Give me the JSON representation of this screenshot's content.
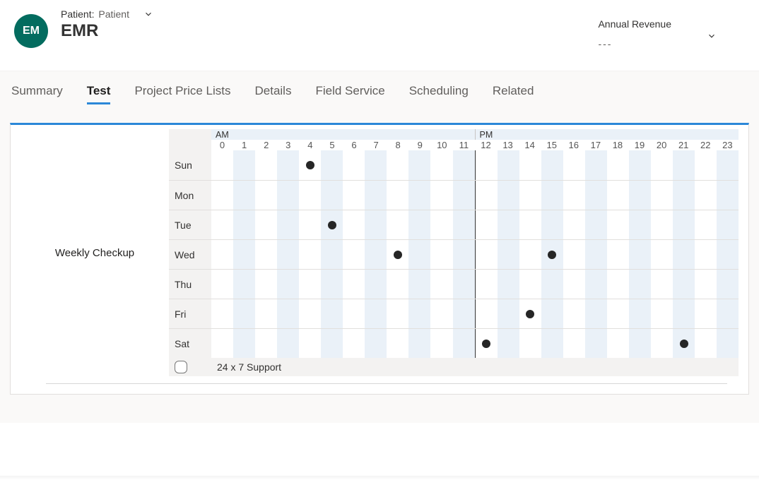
{
  "header": {
    "avatar_initials": "EM",
    "patient_label_prefix": "Patient:",
    "patient_value": "Patient",
    "entity_name": "EMR",
    "revenue_label": "Annual Revenue",
    "revenue_value": "---"
  },
  "tabs": [
    {
      "label": "Summary",
      "active": false
    },
    {
      "label": "Test",
      "active": true
    },
    {
      "label": "Project Price Lists",
      "active": false
    },
    {
      "label": "Details",
      "active": false
    },
    {
      "label": "Field Service",
      "active": false
    },
    {
      "label": "Scheduling",
      "active": false
    },
    {
      "label": "Related",
      "active": false
    }
  ],
  "schedule": {
    "title": "Weekly Checkup",
    "am_label": "AM",
    "pm_label": "PM",
    "hours": [
      0,
      1,
      2,
      3,
      4,
      5,
      6,
      7,
      8,
      9,
      10,
      11,
      12,
      13,
      14,
      15,
      16,
      17,
      18,
      19,
      20,
      21,
      22,
      23
    ],
    "days": [
      {
        "name": "Sun",
        "marks": [
          4
        ]
      },
      {
        "name": "Mon",
        "marks": []
      },
      {
        "name": "Tue",
        "marks": [
          5
        ]
      },
      {
        "name": "Wed",
        "marks": [
          8,
          15
        ]
      },
      {
        "name": "Thu",
        "marks": []
      },
      {
        "name": "Fri",
        "marks": [
          14
        ]
      },
      {
        "name": "Sat",
        "marks": [
          12,
          21
        ]
      }
    ],
    "support_checkbox_checked": false,
    "support_label": "24 x 7 Support"
  }
}
